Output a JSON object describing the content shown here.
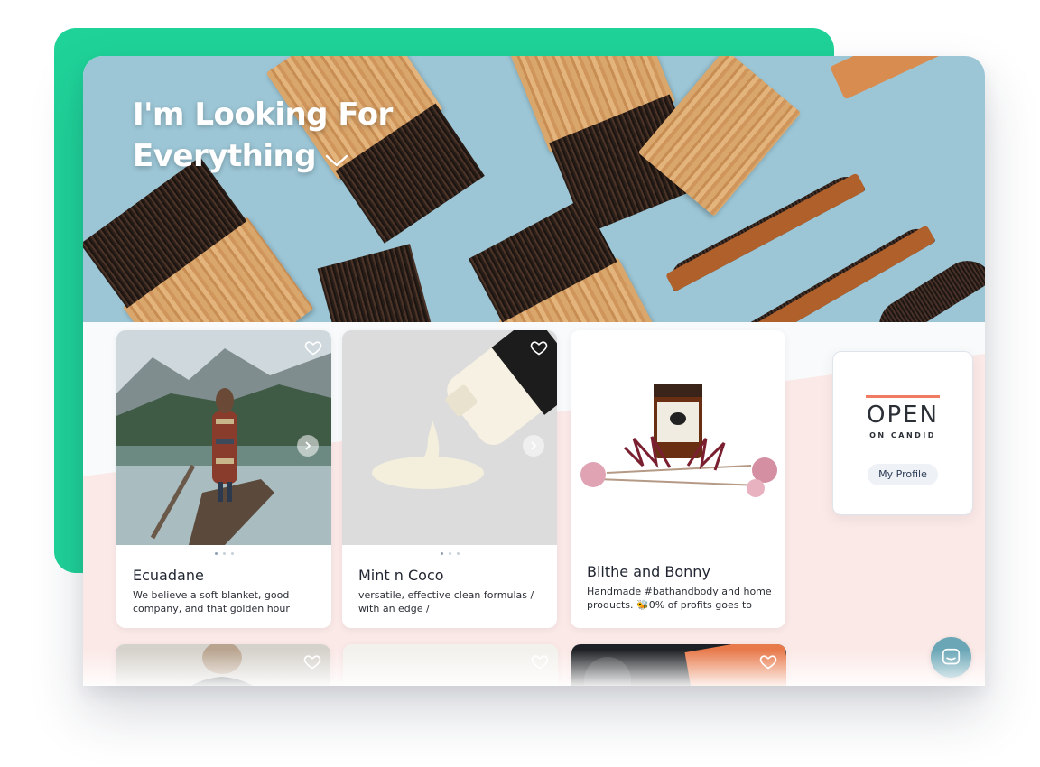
{
  "hero": {
    "title_line1": "I'm Looking For",
    "title_line2": "Everything"
  },
  "cards": [
    {
      "name": "Ecuadane",
      "description": "We believe a soft blanket, good company, and that golden hour"
    },
    {
      "name": "Mint n Coco",
      "description": "versatile, effective clean formulas / with an edge /"
    },
    {
      "name": "Blithe and Bonny",
      "description": "Handmade #bathandbody and home products. 🐝0% of profits goes to"
    }
  ],
  "open_card": {
    "title": "OPEN",
    "subtitle": "ON CANDID",
    "profile_button": "My Profile"
  },
  "colors": {
    "green_accent": "#1fd398",
    "coral_accent": "#ef7b63",
    "sky_blue": "#9cc6d6",
    "pink_band": "#fbe9e7",
    "chat_bubble": "#6aa6b6"
  },
  "icons": [
    "chevron-down-icon",
    "heart-icon",
    "arrow-right-icon",
    "chat-icon"
  ]
}
